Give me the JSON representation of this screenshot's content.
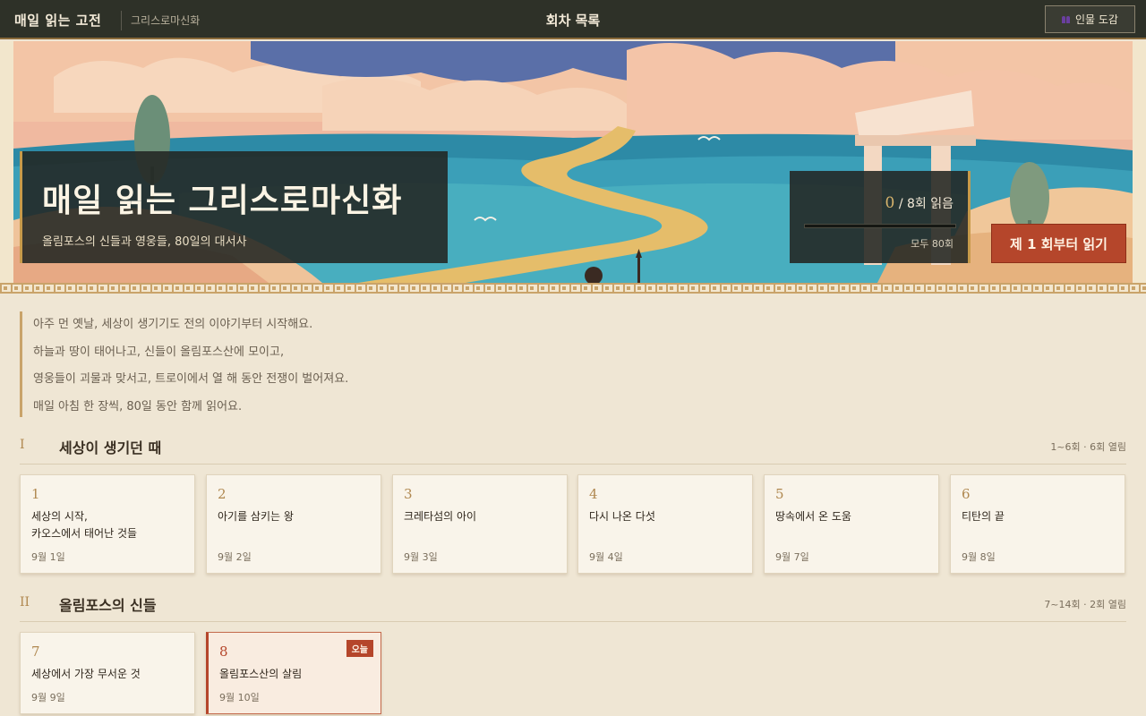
{
  "header": {
    "brand": "매일 읽는 고전",
    "series": "그리스로마신화",
    "center_title": "회차 목록",
    "people_button": "인물 도감",
    "people_icon": "people-icon"
  },
  "hero": {
    "title": "매일 읽는 그리스로마신화",
    "subtitle": "올림포스의 신들과 영웅들, 80일의 대서사",
    "progress": {
      "read": "0",
      "sep": " / ",
      "total_label": "8회 읽음",
      "read_fraction": 0,
      "all_label": "모두 80회"
    },
    "start_button": "제 1 회부터 읽기"
  },
  "intro": [
    "아주 먼 옛날, 세상이 생기기도 전의 이야기부터 시작해요.",
    "하늘과 땅이 태어나고, 신들이 올림포스산에 모이고,",
    "영웅들이 괴물과 맞서고, 트로이에서 열 해 동안 전쟁이 벌어져요.",
    "매일 아침 한 장씩, 80일 동안 함께 읽어요."
  ],
  "sections": [
    {
      "roman": "I",
      "name": "세상이 생기던 때",
      "meta": "1~6회 · 6회 열림",
      "episodes": [
        {
          "num": "1",
          "title": "세상의 시작,\n카오스에서 태어난 것들",
          "date": "9월 1일"
        },
        {
          "num": "2",
          "title": "아기를 삼키는 왕",
          "date": "9월 2일"
        },
        {
          "num": "3",
          "title": "크레타섬의 아이",
          "date": "9월 3일"
        },
        {
          "num": "4",
          "title": "다시 나온 다섯",
          "date": "9월 4일"
        },
        {
          "num": "5",
          "title": "땅속에서 온 도움",
          "date": "9월 7일"
        },
        {
          "num": "6",
          "title": "티탄의 끝",
          "date": "9월 8일"
        }
      ]
    },
    {
      "roman": "II",
      "name": "올림포스의 신들",
      "meta": "7~14회 · 2회 열림",
      "episodes": [
        {
          "num": "7",
          "title": "세상에서 가장 무서운 것",
          "date": "9월 9일"
        },
        {
          "num": "8",
          "title": "올림포스산의 살림",
          "date": "9월 10일",
          "badge": "오늘"
        }
      ]
    }
  ],
  "colors": {
    "accent": "#b5462b",
    "gold": "#c79a4a",
    "topbar": "#2e3128",
    "paper": "#efe6d4"
  }
}
